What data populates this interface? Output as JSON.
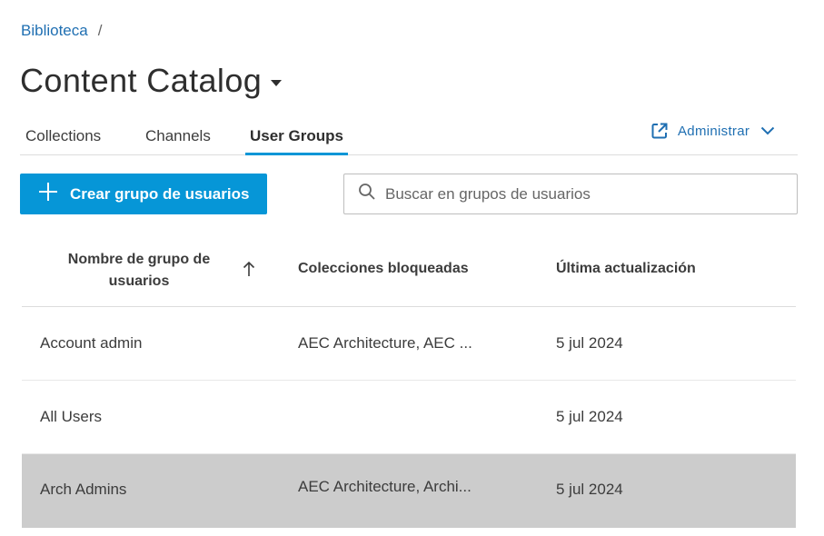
{
  "breadcrumb": {
    "link": "Biblioteca",
    "separator": "/"
  },
  "page": {
    "title": "Content Catalog"
  },
  "tabs": [
    {
      "label": "Collections"
    },
    {
      "label": "Channels"
    },
    {
      "label": "User Groups"
    }
  ],
  "admin": {
    "label": "Administrar",
    "icon": "external-link-icon"
  },
  "create_button": {
    "label": "Crear grupo de usuarios",
    "icon": "plus-icon"
  },
  "search": {
    "placeholder": "Buscar en grupos de usuarios",
    "value": "",
    "icon": "search-icon"
  },
  "colors": {
    "accent": "#0696d7",
    "link": "#1f6fb2",
    "selected_row": "#cccccc"
  },
  "table": {
    "headers": {
      "name": "Nombre de grupo de usuarios",
      "locked": "Colecciones bloqueadas",
      "updated": "Última actualización"
    },
    "sort": {
      "column": "name",
      "direction": "ascending",
      "icon": "arrow-up-icon"
    },
    "rows": [
      {
        "name": "Account admin",
        "locked": "AEC Architecture, AEC ...",
        "updated": "5 jul 2024",
        "selected": false
      },
      {
        "name": "All Users",
        "locked": "",
        "updated": "5 jul 2024",
        "selected": false
      },
      {
        "name": "Arch Admins",
        "locked": "AEC Architecture, Archi...",
        "updated": "5 jul 2024",
        "selected": true
      }
    ]
  }
}
